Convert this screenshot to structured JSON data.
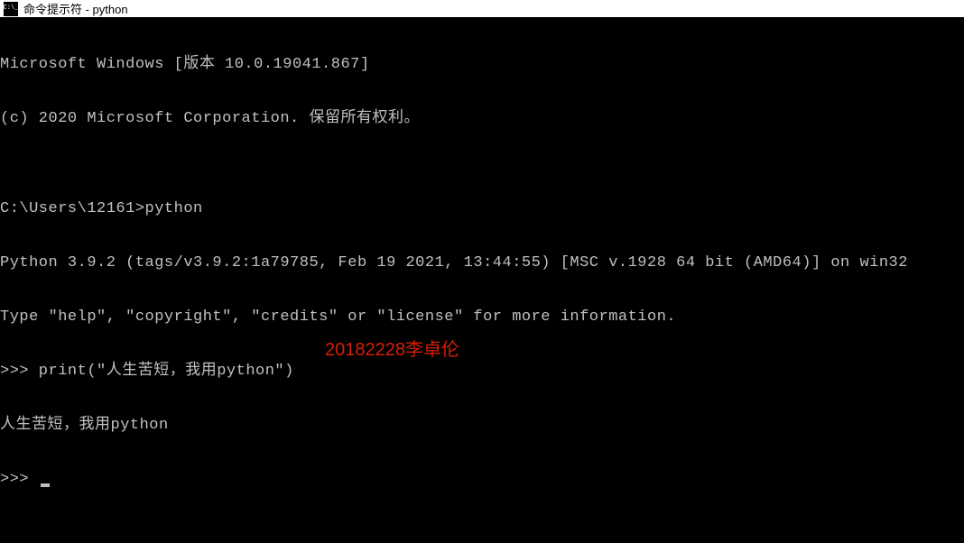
{
  "window": {
    "title": "命令提示符 - python"
  },
  "terminal": {
    "lines": [
      "Microsoft Windows [版本 10.0.19041.867]",
      "(c) 2020 Microsoft Corporation. 保留所有权利。",
      "",
      "C:\\Users\\12161>python",
      "Python 3.9.2 (tags/v3.9.2:1a79785, Feb 19 2021, 13:44:55) [MSC v.1928 64 bit (AMD64)] on win32",
      "Type \"help\", \"copyright\", \"credits\" or \"license\" for more information.",
      ">>> print(\"人生苦短，我用python\")",
      "人生苦短，我用python",
      ">>> "
    ]
  },
  "watermark": {
    "text": "20182228李卓伦"
  }
}
